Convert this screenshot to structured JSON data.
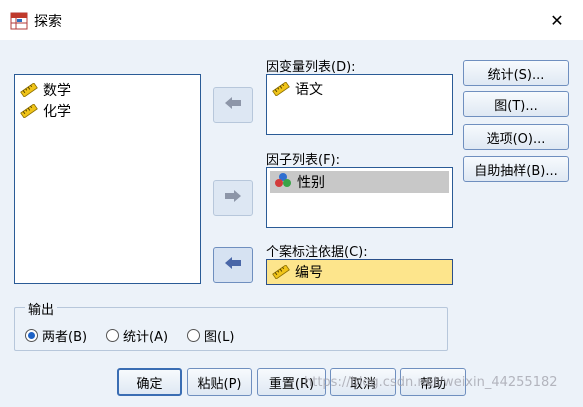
{
  "window": {
    "title": "探索",
    "close_glyph": "✕",
    "app_icon": "spss-table-icon"
  },
  "source_list": {
    "items": [
      {
        "label": "数学",
        "icon": "scale-ruler-icon"
      },
      {
        "label": "化学",
        "icon": "scale-ruler-icon"
      }
    ]
  },
  "dependent_list": {
    "label": "因变量列表(D):",
    "items": [
      {
        "label": "语文",
        "icon": "scale-ruler-icon"
      }
    ]
  },
  "factor_list": {
    "label": "因子列表(F):",
    "items": [
      {
        "label": "性别",
        "icon": "nominal-circles-icon",
        "selected": true
      }
    ]
  },
  "case_label": {
    "label": "个案标注依据(C):",
    "value": {
      "label": "编号",
      "icon": "scale-ruler-icon"
    },
    "highlight_color": "#fde58c"
  },
  "side_buttons": {
    "statistics": "统计(S)...",
    "plots": "图(T)...",
    "options": "选项(O)...",
    "bootstrap": "自助抽样(B)..."
  },
  "output": {
    "legend": "输出",
    "options": [
      {
        "label": "两者(B)",
        "checked": true
      },
      {
        "label": "统计(A)",
        "checked": false
      },
      {
        "label": "图(L)",
        "checked": false
      }
    ]
  },
  "bottom_buttons": {
    "ok": "确定",
    "paste": "粘贴(P)",
    "reset": "重置(R)",
    "cancel": "取消",
    "help": "帮助"
  },
  "watermark": "https://blog.csdn.net/weixin_44255182",
  "colors": {
    "dialog_bg": "#ecf2f9",
    "list_border": "#2a5b96",
    "selected_row": "#c8c8c8",
    "arrow_active": "#4a67a8",
    "arrow_inactive": "#8d96a8"
  }
}
